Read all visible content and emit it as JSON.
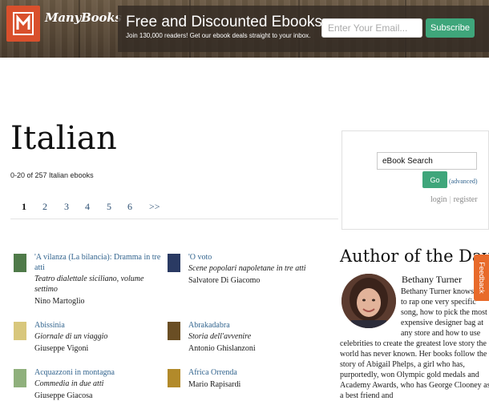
{
  "header": {
    "logo_text": "ManyBooks",
    "promo_title": "Free and Discounted Ebooks",
    "promo_subtitle": "Join 130,000 readers! Get our ebook deals straight to your inbox.",
    "email_placeholder": "Enter Your Email...",
    "subscribe_label": "Subscribe"
  },
  "page": {
    "title": "Italian",
    "results_count": "0-20 of 257 Italian ebooks"
  },
  "pager": {
    "pages": [
      "1",
      "2",
      "3",
      "4",
      "5",
      "6"
    ],
    "next_label": ">>",
    "current": "1"
  },
  "books": [
    {
      "title": "'A vilanza (La bilancia): Dramma in tre atti",
      "subtitle": "Teatro dialettale siciliano, volume settimo",
      "author": "Nino Martoglio",
      "cover_color": "#4f7a49"
    },
    {
      "title": "'O voto",
      "subtitle": "Scene popolari napoletane in tre atti",
      "author": "Salvatore Di Giacomo",
      "cover_color": "#2a3a63"
    },
    {
      "title": "Abissinia",
      "subtitle": "Giornale di un viaggio",
      "author": "Giuseppe Vigoni",
      "cover_color": "#d8c77c"
    },
    {
      "title": "Abrakadabra",
      "subtitle": "Storia dell'avvenire",
      "author": "Antonio Ghislanzoni",
      "cover_color": "#6a4e24"
    },
    {
      "title": "Acquazzoni in montagna",
      "subtitle": "Commedia in due atti",
      "author": "Giuseppe Giacosa",
      "cover_color": "#8fb07c"
    },
    {
      "title": "Africa Orrenda",
      "subtitle": "",
      "author": "Mario Rapisardi",
      "cover_color": "#b28a2a"
    }
  ],
  "sidebar": {
    "search_value": "eBook Search",
    "go_label": "Go",
    "advanced_label": "(advanced)",
    "login_label": "login",
    "separator": "|",
    "register_label": "register",
    "aotd_heading": "Author of the Day",
    "aotd_name": "Bethany Turner",
    "aotd_bio": "Bethany Turner knows how to rap one very specific song, how to pick the most expensive designer bag at any store and how to use celebrities to create the greatest love story the world has never known. Her books follow the story of Abigail Phelps, a girl who has, purportedly, won Olympic gold medals and Academy Awards, who has George Clooney as a best friend and"
  },
  "feedback": {
    "label": "Feedback"
  },
  "colors": {
    "accent_green": "#3fa67b",
    "logo_red": "#d9502c",
    "link_blue": "#33658f",
    "feedback_orange": "#e86a2a"
  }
}
